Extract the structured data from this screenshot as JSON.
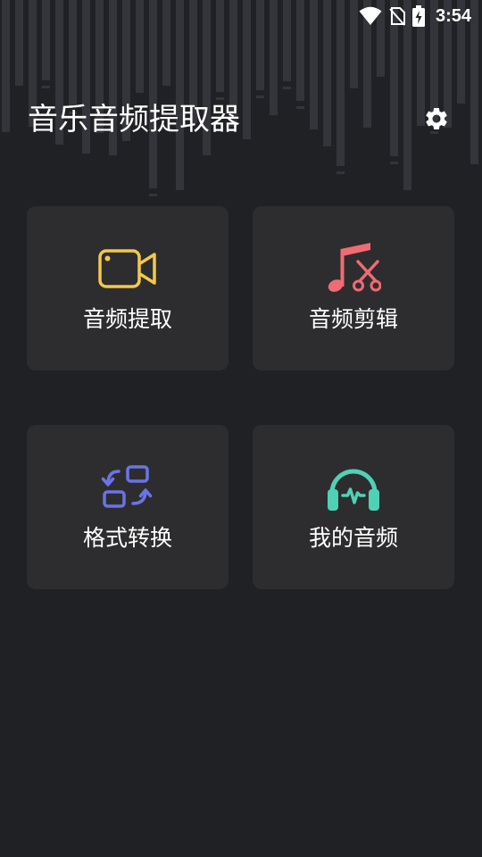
{
  "status_bar": {
    "time": "3:54",
    "icons": [
      "wifi-icon",
      "no-sim-icon",
      "battery-charging-icon"
    ]
  },
  "header": {
    "title": "音乐音频提取器",
    "settings_icon": "gear-icon"
  },
  "features": [
    {
      "label": "音频提取",
      "icon": "video-camera-icon",
      "color": "#f2c94c"
    },
    {
      "label": "音频剪辑",
      "icon": "music-note-scissors-icon",
      "color": "#f06b73"
    },
    {
      "label": "格式转换",
      "icon": "swap-boxes-icon",
      "color": "#6b74e6"
    },
    {
      "label": "我的音频",
      "icon": "headphones-waveform-icon",
      "color": "#4fd1b5"
    }
  ],
  "theme": {
    "background": "#202124",
    "card": "#2d2d2f",
    "text": "#ffffff"
  }
}
